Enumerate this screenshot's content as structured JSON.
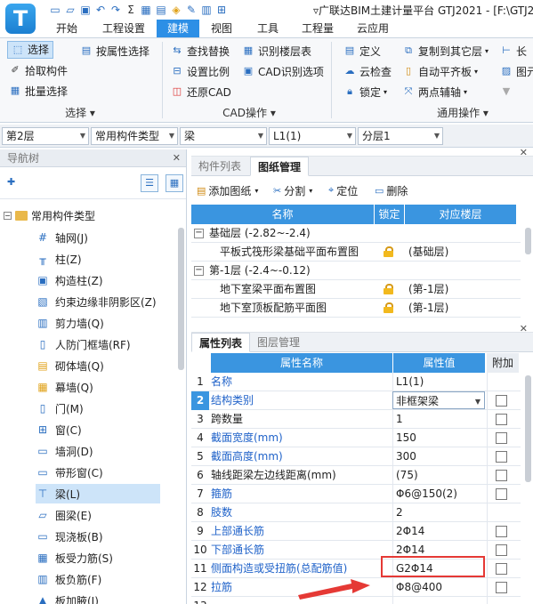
{
  "app": {
    "logo_letter": "T",
    "title": "▿广联达BIM土建计量平台 GTJ2021 - [F:\\GTJ2"
  },
  "quick_access_icons": [
    "new-file-icon",
    "open-folder-icon",
    "save-icon",
    "undo-icon",
    "redo-icon",
    "sum-icon",
    "grid-icon",
    "ruler-icon",
    "fill-icon",
    "edit-icon",
    "table-icon",
    "pin-icon"
  ],
  "menu": {
    "tabs": [
      "开始",
      "工程设置",
      "建模",
      "视图",
      "工具",
      "工程量",
      "云应用"
    ],
    "active": "建模"
  },
  "ribbon": {
    "select_group": {
      "label": "选择",
      "buttons": [
        "选择",
        "按属性选择",
        "拾取构件",
        "批量选择"
      ]
    },
    "cad_group": {
      "label": "CAD操作",
      "buttons": [
        "查找替换",
        "识别楼层表",
        "设置比例",
        "CAD识别选项",
        "还原CAD"
      ]
    },
    "common_group": {
      "label": "通用操作",
      "buttons": [
        "定义",
        "复制到其它层",
        "长",
        "云检查",
        "自动平齐板",
        "图元",
        "锁定",
        "两点辅轴"
      ]
    }
  },
  "selectors": {
    "floor": "第2层",
    "category": "常用构件类型",
    "type": "梁",
    "component": "L1(1)",
    "sublayer": "分层1"
  },
  "nav": {
    "title": "导航树",
    "root": "常用构件类型",
    "items": [
      {
        "label": "轴网(J)",
        "icon": "axis-grid-icon"
      },
      {
        "label": "柱(Z)",
        "icon": "column-icon"
      },
      {
        "label": "构造柱(Z)",
        "icon": "constructional-column-icon"
      },
      {
        "label": "约束边缘非阴影区(Z)",
        "icon": "edge-zone-icon"
      },
      {
        "label": "剪力墙(Q)",
        "icon": "shear-wall-icon"
      },
      {
        "label": "人防门框墙(RF)",
        "icon": "door-frame-wall-icon"
      },
      {
        "label": "砌体墙(Q)",
        "icon": "masonry-wall-icon"
      },
      {
        "label": "幕墙(Q)",
        "icon": "curtain-wall-icon"
      },
      {
        "label": "门(M)",
        "icon": "door-icon"
      },
      {
        "label": "窗(C)",
        "icon": "window-icon"
      },
      {
        "label": "墙洞(D)",
        "icon": "wall-hole-icon"
      },
      {
        "label": "带形窗(C)",
        "icon": "strip-window-icon"
      },
      {
        "label": "梁(L)",
        "icon": "beam-icon"
      },
      {
        "label": "圈梁(E)",
        "icon": "ring-beam-icon"
      },
      {
        "label": "现浇板(B)",
        "icon": "slab-icon"
      },
      {
        "label": "板受力筋(S)",
        "icon": "slab-rebar-icon"
      },
      {
        "label": "板负筋(F)",
        "icon": "negative-rebar-icon"
      },
      {
        "label": "板加腋(J)",
        "icon": "slab-haunch-icon"
      }
    ],
    "active_index": 12
  },
  "drawings": {
    "tabs": [
      "构件列表",
      "图纸管理"
    ],
    "active_tab": "图纸管理",
    "toolbar": [
      "添加图纸",
      "分割",
      "定位",
      "删除"
    ],
    "columns": [
      "名称",
      "锁定",
      "对应楼层"
    ],
    "rows": [
      {
        "group": true,
        "name": "基础层 (-2.82~-2.4)",
        "floor": ""
      },
      {
        "group": false,
        "name": "平板式筏形梁基础平面布置图",
        "floor": "(基础层)"
      },
      {
        "group": true,
        "name": "第-1层 (-2.4~-0.12)",
        "floor": ""
      },
      {
        "group": false,
        "name": "地下室梁平面布置图",
        "floor": "(第-1层)"
      },
      {
        "group": false,
        "name": "地下室顶板配筋平面图",
        "floor": "(第-1层)"
      }
    ]
  },
  "properties": {
    "tabs": [
      "属性列表",
      "图层管理"
    ],
    "active_tab": "属性列表",
    "columns": [
      "属性名称",
      "属性值",
      "附加"
    ],
    "rows": [
      {
        "num": "1",
        "name": "名称",
        "value": "L1(1)",
        "blue": true,
        "checkbox": false
      },
      {
        "num": "2",
        "name": "结构类别",
        "value": "非框架梁",
        "blue": true,
        "checkbox": true,
        "dropdown": true
      },
      {
        "num": "3",
        "name": "跨数量",
        "value": "1",
        "blue": false,
        "checkbox": true
      },
      {
        "num": "4",
        "name": "截面宽度(mm)",
        "value": "150",
        "blue": true,
        "checkbox": true
      },
      {
        "num": "5",
        "name": "截面高度(mm)",
        "value": "300",
        "blue": true,
        "checkbox": true
      },
      {
        "num": "6",
        "name": "轴线距梁左边线距离(mm)",
        "value": "(75)",
        "blue": false,
        "checkbox": true
      },
      {
        "num": "7",
        "name": "箍筋",
        "value": "Φ6@150(2)",
        "blue": true,
        "checkbox": true
      },
      {
        "num": "8",
        "name": "肢数",
        "value": "2",
        "blue": true,
        "checkbox": false
      },
      {
        "num": "9",
        "name": "上部通长筋",
        "value": "2Φ14",
        "blue": true,
        "checkbox": true
      },
      {
        "num": "10",
        "name": "下部通长筋",
        "value": "2Φ14",
        "blue": true,
        "checkbox": true
      },
      {
        "num": "11",
        "name": "侧面构造或受扭筋(总配筋值)",
        "value": "G2Φ14",
        "blue": true,
        "checkbox": true
      },
      {
        "num": "12",
        "name": "拉筋",
        "value": "Φ8@400",
        "blue": true,
        "checkbox": true
      },
      {
        "num": "13",
        "name": "",
        "value": "",
        "blue": true,
        "checkbox": false
      }
    ],
    "highlight_num": "2"
  },
  "colors": {
    "accent": "#2d8fe6",
    "header_blue": "#3a95e0",
    "annotation_red": "#e53935"
  }
}
